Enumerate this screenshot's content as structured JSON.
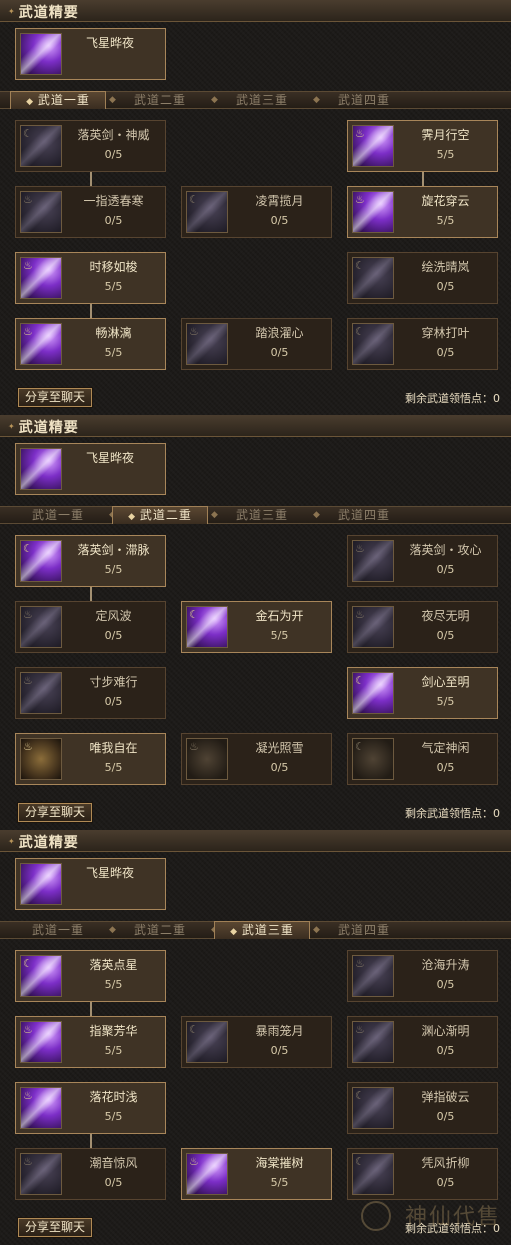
{
  "header_title": "武道精要",
  "top_skill": {
    "name": "飞星晔夜",
    "icon": "purple-starfall-icon"
  },
  "tabs": [
    "武道一重",
    "武道二重",
    "武道三重",
    "武道四重"
  ],
  "share_label": "分享至聊天",
  "remaining_label": "剩余武道领悟点：0",
  "watermark": "神仙代售",
  "panels": [
    {
      "active_tab": 0,
      "cards": [
        {
          "name": "落英剑・神威",
          "level": "0/5",
          "on": false
        },
        {
          "name": "霁月行空",
          "level": "5/5",
          "on": true
        },
        {
          "name": "一指透春寒",
          "level": "0/5",
          "on": false
        },
        {
          "name": "凌霄揽月",
          "level": "0/5",
          "on": false
        },
        {
          "name": "旋花穿云",
          "level": "5/5",
          "on": true
        },
        {
          "name": "时移如梭",
          "level": "5/5",
          "on": true
        },
        {
          "name": "绘洗晴岚",
          "level": "0/5",
          "on": false
        },
        {
          "name": "畅淋漓",
          "level": "5/5",
          "on": true
        },
        {
          "name": "踏浪濯心",
          "level": "0/5",
          "on": false
        },
        {
          "name": "穿林打叶",
          "level": "0/5",
          "on": false
        }
      ]
    },
    {
      "active_tab": 1,
      "cards": [
        {
          "name": "落英剑・滞脉",
          "level": "5/5",
          "on": true
        },
        {
          "name": "落英剑・攻心",
          "level": "0/5",
          "on": false
        },
        {
          "name": "定风波",
          "level": "0/5",
          "on": false
        },
        {
          "name": "金石为开",
          "level": "5/5",
          "on": true
        },
        {
          "name": "夜尽无明",
          "level": "0/5",
          "on": false
        },
        {
          "name": "寸步难行",
          "level": "0/5",
          "on": false
        },
        {
          "name": "剑心至明",
          "level": "5/5",
          "on": true
        },
        {
          "name": "唯我自在",
          "level": "5/5",
          "on": true
        },
        {
          "name": "凝光照雪",
          "level": "0/5",
          "on": false
        },
        {
          "name": "气定神闲",
          "level": "0/5",
          "on": false
        }
      ]
    },
    {
      "active_tab": 2,
      "cards": [
        {
          "name": "落英点星",
          "level": "5/5",
          "on": true
        },
        {
          "name": "沧海升涛",
          "level": "0/5",
          "on": false
        },
        {
          "name": "指聚芳华",
          "level": "5/5",
          "on": true
        },
        {
          "name": "暴雨笼月",
          "level": "0/5",
          "on": false
        },
        {
          "name": "渊心渐明",
          "level": "0/5",
          "on": false
        },
        {
          "name": "落花时浅",
          "level": "5/5",
          "on": true
        },
        {
          "name": "弹指破云",
          "level": "0/5",
          "on": false
        },
        {
          "name": "潮音惊风",
          "level": "0/5",
          "on": false
        },
        {
          "name": "海棠摧树",
          "level": "5/5",
          "on": true
        },
        {
          "name": "凭风折柳",
          "level": "0/5",
          "on": false
        }
      ]
    }
  ]
}
